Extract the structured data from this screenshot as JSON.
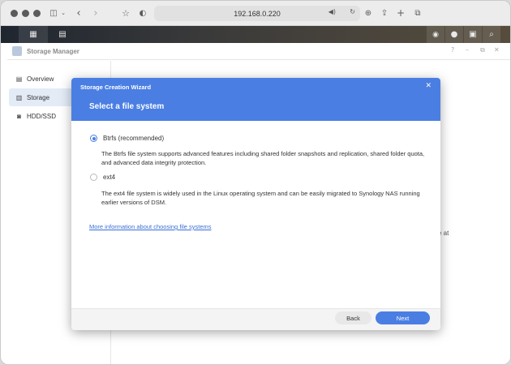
{
  "browser": {
    "url": "192.168.0.220"
  },
  "app": {
    "title": "Storage Manager",
    "window_controls": [
      "?",
      "–",
      "⧉",
      "✕"
    ]
  },
  "sidebar": {
    "items": [
      {
        "label": "Overview",
        "active": false
      },
      {
        "label": "Storage",
        "active": true
      },
      {
        "label": "HDD/SSD",
        "active": false
      }
    ]
  },
  "background_text": "e at",
  "wizard": {
    "header": "Storage Creation Wizard",
    "title": "Select a file system",
    "close": "✕",
    "options": [
      {
        "label": "Btrfs (recommended)",
        "selected": true,
        "description": "The Btrfs file system supports advanced features including shared folder snapshots and replication, shared folder quota, and advanced data integrity protection."
      },
      {
        "label": "ext4",
        "selected": false,
        "description": "The ext4 file system is widely used in the Linux operating system and can be easily migrated to Synology NAS running earlier versions of DSM."
      }
    ],
    "link": "More information about choosing file systems",
    "back_label": "Back",
    "next_label": "Next"
  },
  "colors": {
    "accent": "#4a7ee3",
    "nav_active": "#e3ebf7"
  }
}
